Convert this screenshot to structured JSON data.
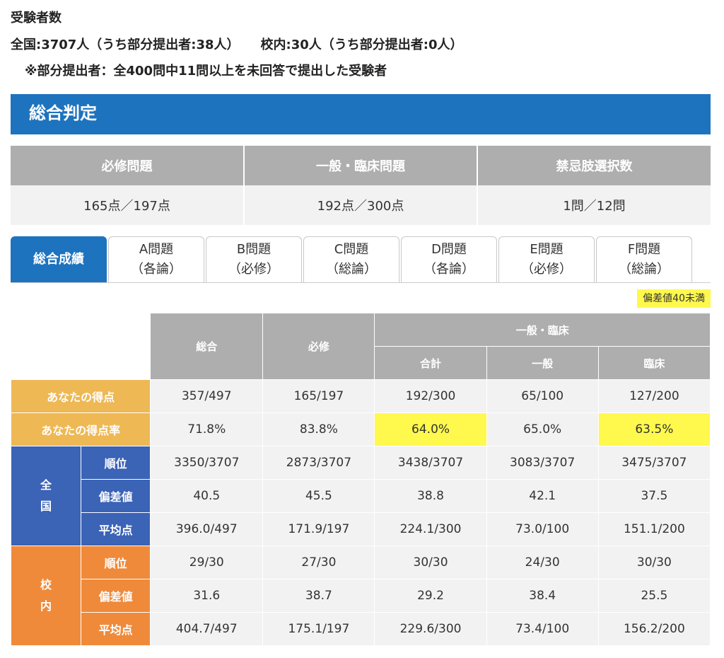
{
  "examinees": {
    "title": "受験者数",
    "national": "全国:3707人（うち部分提出者:38人）",
    "school": "校内:30人（うち部分提出者:0人）",
    "note": "※部分提出者：全400問中11問以上を未回答で提出した受験者"
  },
  "overall": {
    "title": "総合判定",
    "headers": [
      "必修問題",
      "一般・臨床問題",
      "禁忌肢選択数"
    ],
    "values": [
      "165点／197点",
      "192点／300点",
      "1問／12問"
    ]
  },
  "tabs": [
    {
      "line1": "総合成績",
      "line2": ""
    },
    {
      "line1": "A問題",
      "line2": "（各論）"
    },
    {
      "line1": "B問題",
      "line2": "（必修）"
    },
    {
      "line1": "C問題",
      "line2": "（総論）"
    },
    {
      "line1": "D問題",
      "line2": "（各論）"
    },
    {
      "line1": "E問題",
      "line2": "（必修）"
    },
    {
      "line1": "F問題",
      "line2": "（総論）"
    }
  ],
  "legend": "偏差値40未満",
  "table": {
    "headers": {
      "total": "総合",
      "required": "必修",
      "general_clinical": "一般・臨床",
      "sum": "合計",
      "general": "一般",
      "clinical": "臨床"
    },
    "score_label": "あなたの得点",
    "rate_label": "あなたの得点率",
    "national_label": "全国",
    "school_label": "校内",
    "rank_label": "順位",
    "deviation_label": "偏差値",
    "average_label": "平均点",
    "score": [
      "357/497",
      "165/197",
      "192/300",
      "65/100",
      "127/200"
    ],
    "rate": [
      "71.8%",
      "83.8%",
      "64.0%",
      "65.0%",
      "63.5%"
    ],
    "national": {
      "rank": [
        "3350/3707",
        "2873/3707",
        "3438/3707",
        "3083/3707",
        "3475/3707"
      ],
      "deviation": [
        "40.5",
        "45.5",
        "38.8",
        "42.1",
        "37.5"
      ],
      "average": [
        "396.0/497",
        "171.9/197",
        "224.1/300",
        "73.0/100",
        "151.1/200"
      ]
    },
    "school": {
      "rank": [
        "29/30",
        "27/30",
        "30/30",
        "24/30",
        "30/30"
      ],
      "deviation": [
        "31.6",
        "38.7",
        "29.2",
        "38.4",
        "25.5"
      ],
      "average": [
        "404.7/497",
        "175.1/197",
        "229.6/300",
        "73.4/100",
        "156.2/200"
      ]
    }
  },
  "colors": {
    "blue_header": "#1e73be",
    "gray_header": "#aeaeae",
    "score_label": "#eeb854",
    "national_label": "#3b63b6",
    "school_label": "#ef8a3a",
    "highlight": "#fff84d"
  }
}
